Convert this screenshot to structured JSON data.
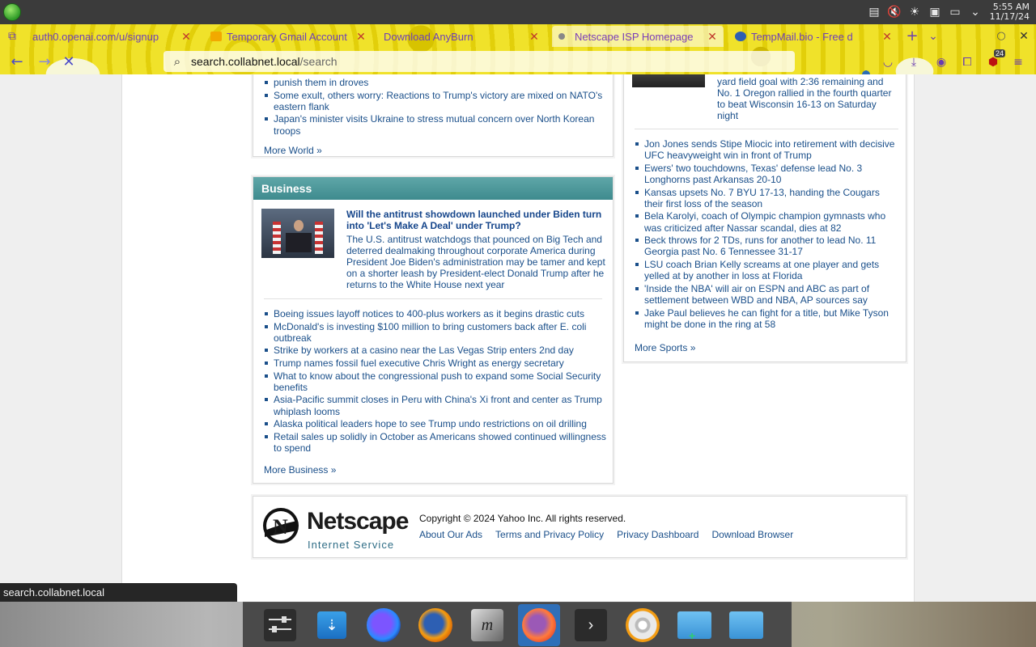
{
  "os": {
    "clock_time": "5:55 AM",
    "clock_date": "11/17/24",
    "tray_icons": [
      "clipboard-icon",
      "volume-muted-icon",
      "brightness-icon",
      "save-icon",
      "display-icon",
      "chevron-down-icon"
    ]
  },
  "browser": {
    "tabs": [
      {
        "label": "auth0.openai.com/u/signup",
        "active": false
      },
      {
        "label": "Temporary Gmail Account",
        "active": false
      },
      {
        "label": "Download AnyBurn",
        "active": false
      },
      {
        "label": "Netscape ISP Homepage",
        "active": true
      },
      {
        "label": "TempMail.bio - Free d",
        "active": false
      }
    ],
    "url_host": "search.collabnet.local",
    "url_path": "/search",
    "extensions_badge": "24"
  },
  "world": {
    "items": [
      "punish them in droves",
      "Some exult, others worry: Reactions to Trump's victory are mixed on NATO's eastern flank",
      "Japan's minister visits Ukraine to stress mutual concern over North Korean troops"
    ],
    "more": "More World »"
  },
  "business": {
    "title": "Business",
    "headline": "Will the antitrust showdown launched under Biden turn into 'Let's Make A Deal' under Trump?",
    "summary": "The U.S. antitrust watchdogs that pounced on Big Tech and deterred dealmaking throughout corporate America during President Joe Biden's administration may be tamer and kept on a shorter leash by President-elect Donald Trump after he returns to the White House next year",
    "items": [
      "Boeing issues layoff notices to 400-plus workers as it begins drastic cuts",
      "McDonald's is investing $100 million to bring customers back after E. coli outbreak",
      "Strike by workers at a casino near the Las Vegas Strip enters 2nd day",
      "Trump names fossil fuel executive Chris Wright as energy secretary",
      "What to know about the congressional push to expand some Social Security benefits",
      "Asia-Pacific summit closes in Peru with China's Xi front and center as Trump whiplash looms",
      "Alaska political leaders hope to see Trump undo restrictions on oil drilling",
      "Retail sales up solidly in October as Americans showed continued willingness to spend"
    ],
    "more": "More Business »"
  },
  "sports": {
    "lead_summary": "yard field goal with 2:36 remaining and No. 1 Oregon rallied in the fourth quarter to beat Wisconsin 16-13 on Saturday night",
    "items": [
      "Jon Jones sends Stipe Miocic into retirement with decisive UFC heavyweight win in front of Trump",
      "Ewers' two touchdowns, Texas' defense lead No. 3 Longhorns past Arkansas 20-10",
      "Kansas upsets No. 7 BYU 17-13, handing the Cougars their first loss of the season",
      "Bela Karolyi, coach of Olympic champion gymnasts who was criticized after Nassar scandal, dies at 82",
      "Beck throws for 2 TDs, runs for another to lead No. 11 Georgia past No. 6 Tennessee 31-17",
      "LSU coach Brian Kelly screams at one player and gets yelled at by another in loss at Florida",
      "'Inside the NBA' will air on ESPN and ABC as part of settlement between WBD and NBA, AP sources say",
      "Jake Paul believes he can fight for a title, but Mike Tyson might be done in the ring at 58"
    ],
    "more": "More Sports »"
  },
  "footer": {
    "logo_name": "Netscape",
    "logo_sub": "Internet Service",
    "copyright": "Copyright © 2024 Yahoo Inc. All rights reserved.",
    "links": [
      "About Our Ads",
      "Terms and Privacy Policy",
      "Privacy Dashboard",
      "Download Browser"
    ]
  },
  "status_text": "search.collabnet.local",
  "dock": {
    "apps": [
      "settings-icon",
      "store-icon",
      "firefox-dev-icon",
      "firefox-icon",
      "text-editor-icon",
      "firefox-nightly-icon",
      "terminal-icon",
      "disc-burner-icon",
      "file-manager-add-icon",
      "file-manager-icon"
    ]
  }
}
